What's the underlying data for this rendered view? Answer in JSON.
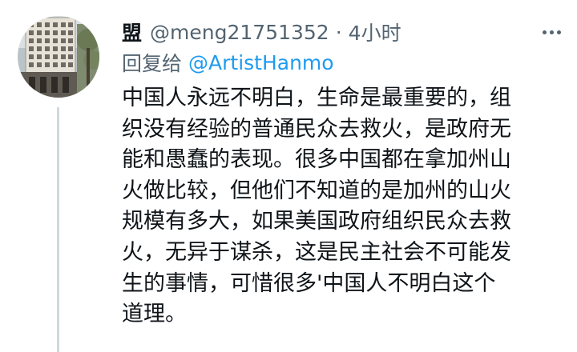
{
  "tweet": {
    "display_name": "盟",
    "handle": "@meng21751352",
    "separator": "·",
    "time": "4小时",
    "reply_label": "回复给",
    "reply_target": "@ArtistHanmo",
    "body_lines": [
      "中国人永远不明白，生命是最重要的，组",
      "织没有经验的普通民众去救火，是政府无",
      "能和愚蠢的表现。很多中国都在拿加州山",
      "火做比较，但他们不知道的是加州的山火",
      "规模有多大，如果美国政府组织民众去救",
      "火，无异于谋杀，这是民主社会不可能发",
      "生的事情，可惜很多'中国人不明白这个",
      "道理。"
    ],
    "more_icon": "more-horizontal-icon",
    "avatar_icon": "building-photo-avatar"
  },
  "colors": {
    "text": "#0f1419",
    "secondary": "#536471",
    "link": "#1d9bf0",
    "thread_line": "#cfd9de"
  }
}
